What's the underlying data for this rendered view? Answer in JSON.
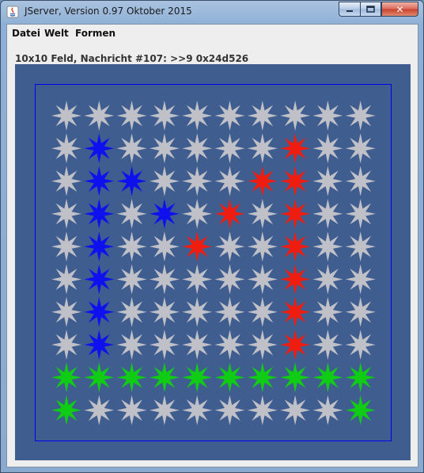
{
  "window": {
    "title": "JServer, Version 0.97 Oktober 2015",
    "close_glyph": "✕"
  },
  "menu": {
    "items": [
      "Datei",
      "Welt",
      "Formen"
    ]
  },
  "status": {
    "text": "10x10 Feld, Nachricht #107: >>9 0x24d526"
  },
  "board": {
    "size": 10,
    "background_color": "#3f5e8f",
    "frame_color": "#0000ee",
    "colors": {
      "S": "#c0c0c8",
      "B": "#1010ee",
      "R": "#ee1d10",
      "G": "#10cc14"
    },
    "rows": [
      "SSSSSSSSSS",
      "SBSSSSSRSS",
      "SBBSSSRRSS",
      "SBSBSRSRSS",
      "SBSSRSSRSS",
      "SBSSSSSRSS",
      "SBSSSSSRSS",
      "SBSSSSSRSS",
      "GGGGGGGGGG",
      "GSSSSSSSSG"
    ]
  }
}
